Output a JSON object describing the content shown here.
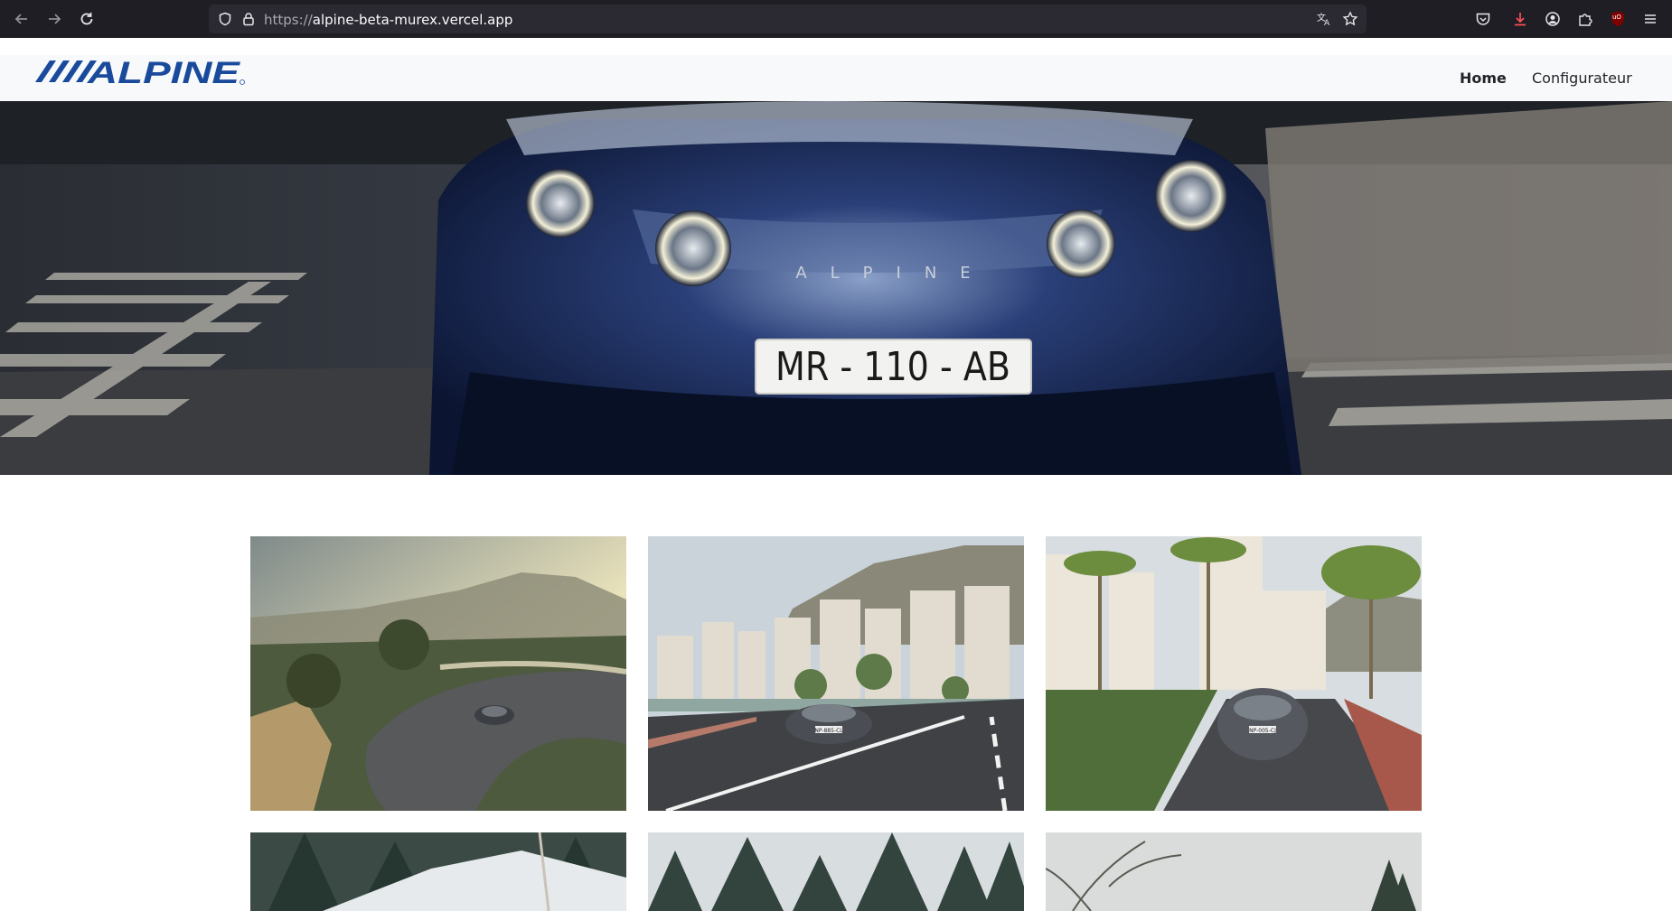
{
  "browser": {
    "url_scheme": "https://",
    "url_host": "alpine-beta-murex.vercel.app",
    "icons": [
      "back-arrow-icon",
      "forward-arrow-icon",
      "reload-icon",
      "shield-icon",
      "lock-icon",
      "translate-icon",
      "star-icon",
      "pocket-icon",
      "download-icon",
      "account-icon",
      "extensions-icon",
      "ublock-icon",
      "menu-icon"
    ],
    "ublock_label": "uO"
  },
  "site": {
    "logo_text": "ALPINE",
    "nav": [
      {
        "label": "Home",
        "active": true
      },
      {
        "label": "Configurateur",
        "active": false
      }
    ],
    "brand_color": "#1a4a9c"
  },
  "hero": {
    "badge_text": "ALPINE",
    "plate_text": "MR - 110 - AB"
  },
  "gallery": {
    "tiles": [
      {
        "name": "coastal-road-tile",
        "plate": ""
      },
      {
        "name": "city-road-tile",
        "plate": "NP-885-CL"
      },
      {
        "name": "palm-street-tile",
        "plate": "NP-005-CJ"
      },
      {
        "name": "snow-forest-tile",
        "plate": ""
      },
      {
        "name": "pine-forest-tile",
        "plate": ""
      },
      {
        "name": "winter-branches-tile",
        "plate": ""
      }
    ]
  }
}
